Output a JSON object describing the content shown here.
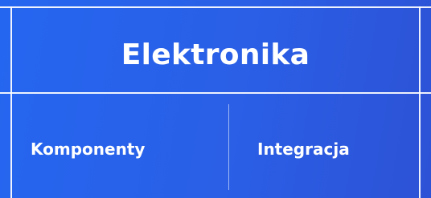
{
  "card": {
    "title": "Elektronika",
    "cells": [
      {
        "label": "Komponenty"
      },
      {
        "label": "Integracja"
      }
    ]
  },
  "colors": {
    "background_start": "#2566f0",
    "background_end": "#2d52d6",
    "text": "#ffffff",
    "lines": "#ffffff"
  }
}
